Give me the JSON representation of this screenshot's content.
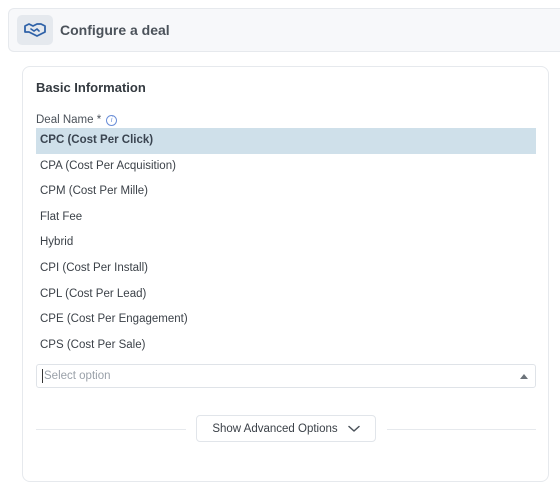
{
  "header": {
    "title": "Configure a deal",
    "icon": "handshake-icon"
  },
  "form": {
    "section_title": "Basic Information",
    "deal_name": {
      "label": "Deal Name *",
      "info_icon": "info-icon",
      "options": [
        "CPC (Cost Per Click)",
        "CPA (Cost Per Acquisition)",
        "CPM (Cost Per Mille)",
        "Flat Fee",
        "Hybrid",
        "CPI (Cost Per Install)",
        "CPL (Cost Per Lead)",
        "CPE (Cost Per Engagement)",
        "CPS (Cost Per Sale)"
      ],
      "highlighted_option": "CPC (Cost Per Click)",
      "placeholder": "Select option"
    },
    "advanced_button_label": "Show Advanced Options"
  },
  "colors": {
    "highlight": "#cfe0ea",
    "icon_accent": "#2f62a8"
  }
}
